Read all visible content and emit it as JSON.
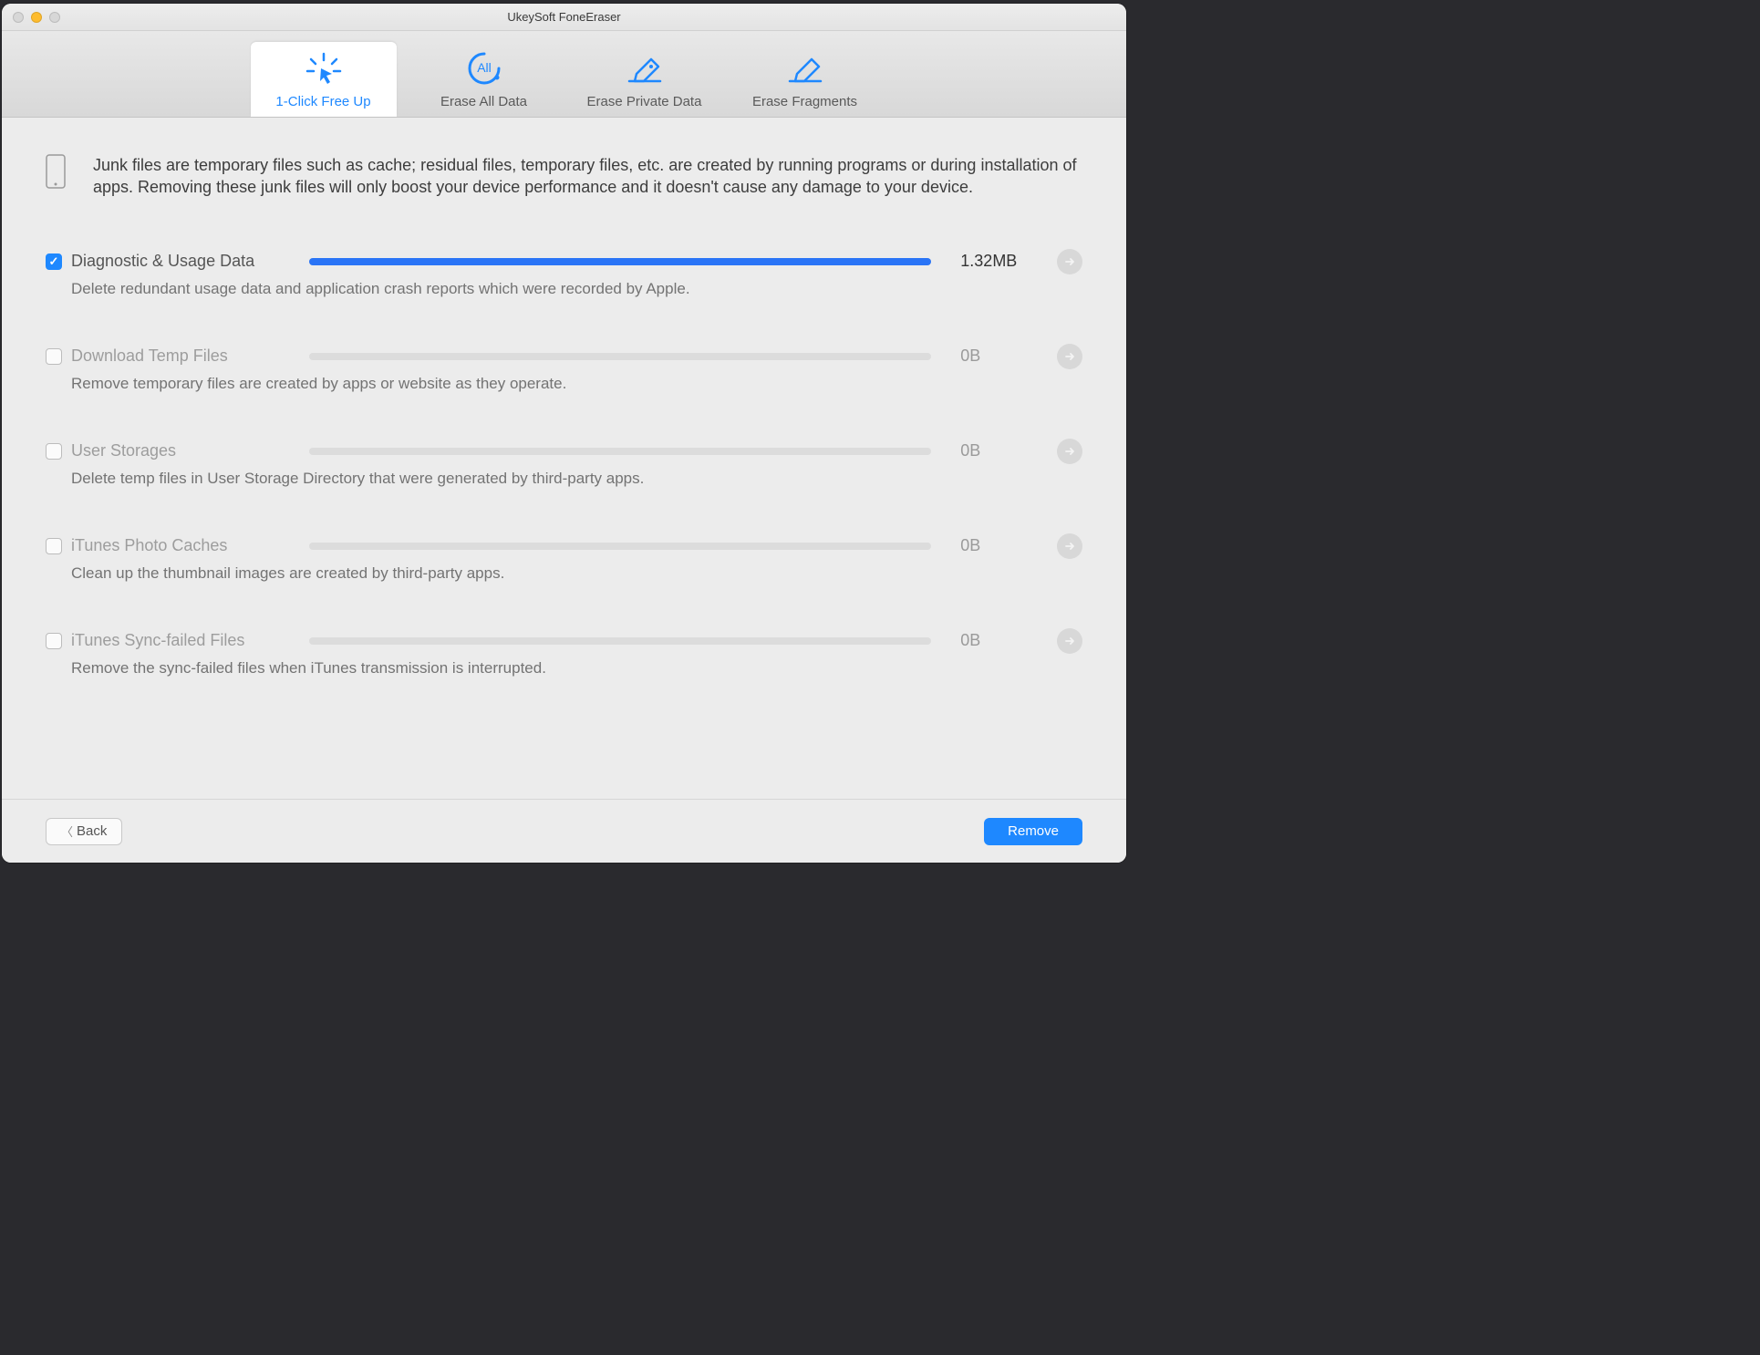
{
  "window": {
    "title": "UkeySoft FoneEraser"
  },
  "tabs": [
    {
      "label": "1-Click Free Up"
    },
    {
      "label": "Erase All Data"
    },
    {
      "label": "Erase Private Data"
    },
    {
      "label": "Erase Fragments"
    }
  ],
  "intro": "Junk files are temporary files such as cache; residual files, temporary files, etc. are created by running programs or during installation of apps. Removing these junk files will only boost your device performance and it doesn't cause any damage to your device.",
  "categories": [
    {
      "title": "Diagnostic & Usage Data",
      "desc": "Delete redundant usage data and application crash reports which were recorded by Apple.",
      "size": "1.32MB",
      "checked": true,
      "fill_pct": 100
    },
    {
      "title": "Download Temp Files",
      "desc": "Remove temporary files are created by apps or website as they operate.",
      "size": "0B",
      "checked": false,
      "fill_pct": 0
    },
    {
      "title": "User Storages",
      "desc": "Delete temp files in User Storage Directory that were generated by third-party apps.",
      "size": "0B",
      "checked": false,
      "fill_pct": 0
    },
    {
      "title": "iTunes Photo Caches",
      "desc": "Clean up the thumbnail images are created by third-party apps.",
      "size": "0B",
      "checked": false,
      "fill_pct": 0
    },
    {
      "title": "iTunes Sync-failed Files",
      "desc": "Remove the sync-failed files when iTunes transmission is interrupted.",
      "size": "0B",
      "checked": false,
      "fill_pct": 0
    }
  ],
  "footer": {
    "back": "Back",
    "remove": "Remove"
  }
}
